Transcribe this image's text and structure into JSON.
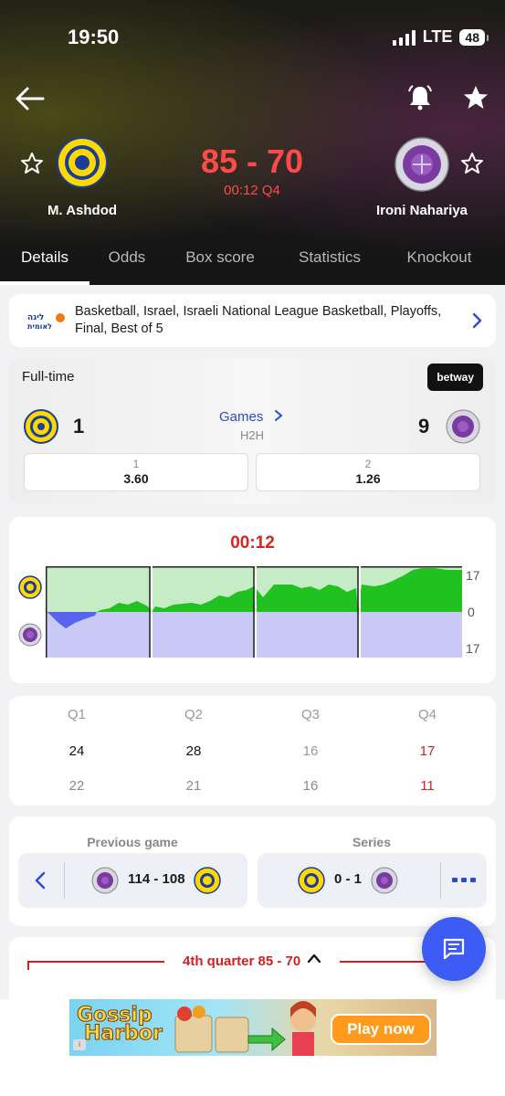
{
  "status_bar": {
    "time": "19:50",
    "network": "LTE",
    "battery": "48"
  },
  "match": {
    "home_team": "M. Ashdod",
    "away_team": "Ironi Nahariya",
    "score": "85 - 70",
    "clock": "00:12 Q4"
  },
  "tabs": [
    "Details",
    "Odds",
    "Box score",
    "Statistics",
    "Knockout"
  ],
  "league": {
    "text": "Basketball, Israel, Israeli National League Basketball, Playoffs, Final, Best of 5"
  },
  "odds": {
    "status": "Full-time",
    "bookmaker": "betway",
    "home_value": "1",
    "away_value": "9",
    "games_link": "Games",
    "h2h": "H2H",
    "options": [
      {
        "label": "1",
        "value": "3.60"
      },
      {
        "label": "2",
        "value": "1.26"
      }
    ]
  },
  "momentum": {
    "clock": "00:12",
    "axis_top": "17",
    "axis_mid": "0",
    "axis_bottom": "17"
  },
  "quarters": {
    "headers": [
      "Q1",
      "Q2",
      "Q3",
      "Q4"
    ],
    "home": [
      "24",
      "28",
      "16",
      "17"
    ],
    "away": [
      "22",
      "21",
      "16",
      "11"
    ]
  },
  "previous_game": {
    "title": "Previous game",
    "score": "114 - 108"
  },
  "series": {
    "title": "Series",
    "score": "0 - 1"
  },
  "quarter_section": {
    "label": "4th quarter 85 - 70"
  },
  "ad": {
    "title_line1": "Gossip",
    "title_line2": "Harbor",
    "cta": "Play now"
  },
  "colors": {
    "accent_red": "#d02020",
    "score_red": "#ff4a4a",
    "link_blue": "#2a4bd7",
    "home_area": "#1fc21f",
    "away_area": "#5a62f0",
    "fab": "#3d5cf5"
  }
}
